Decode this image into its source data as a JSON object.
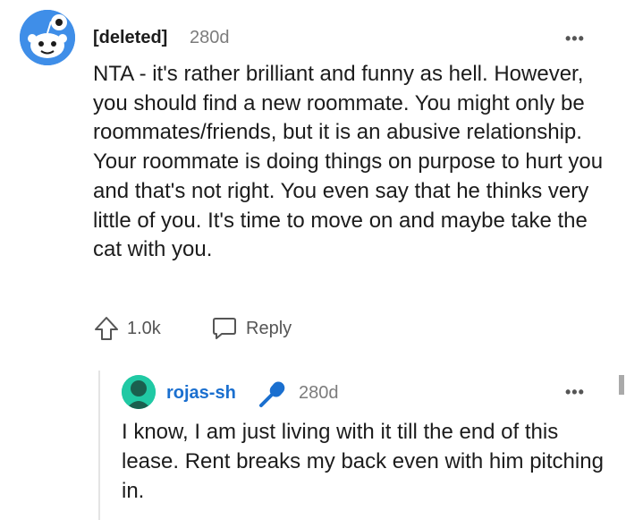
{
  "comment": {
    "author": "[deleted]",
    "age": "280d",
    "more": "•••",
    "body": "NTA - it's rather brilliant and funny as hell. However, you should find a new roommate. You might only be roommates/friends, but it is an abusive relationship. Your roommate is doing things on purpose to hurt you and that's not right. You even say that he thinks very little of you. It's time to move on and maybe take the cat with you.",
    "votes": "1.0k",
    "reply_label": "Reply"
  },
  "reply": {
    "author": "rojas-sh",
    "age": "280d",
    "more": "•••",
    "body": "I know, I am just living with it till the end of this lease. Rent breaks my back even with him pitching in."
  },
  "icons": {
    "main_avatar": "snoo-avatar-icon",
    "reply_avatar": "user-avatar-icon",
    "badge": "microphone-icon",
    "upvote": "upvote-arrow-icon",
    "reply": "speech-bubble-icon",
    "more": "more-options-icon"
  },
  "colors": {
    "main_avatar_bg": "#3f8ee8",
    "reply_avatar_bg": "#20c9a4",
    "reply_username": "#1a6fcf",
    "badge": "#1a6fcf"
  }
}
